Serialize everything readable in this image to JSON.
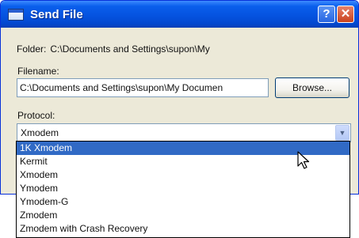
{
  "window": {
    "title": "Send File",
    "help_label": "?",
    "close_label": "✕"
  },
  "folder": {
    "label": "Folder:",
    "value": "C:\\Documents and Settings\\supon\\My"
  },
  "filename": {
    "label": "Filename:",
    "value": "C:\\Documents and Settings\\supon\\My Documen"
  },
  "browse_button": "Browse...",
  "protocol": {
    "label": "Protocol:",
    "selected": "Xmodem",
    "options": [
      "1K Xmodem",
      "Kermit",
      "Xmodem",
      "Ymodem",
      "Ymodem-G",
      "Zmodem",
      "Zmodem with Crash Recovery"
    ],
    "highlighted_index": 0
  },
  "icons": {
    "app": "window-icon",
    "dropdown": "chevron-down-icon",
    "cursor": "mouse-pointer-icon"
  },
  "colors": {
    "title_bar": "#0553e0",
    "highlight": "#316ac5",
    "close_button": "#c9411c"
  }
}
